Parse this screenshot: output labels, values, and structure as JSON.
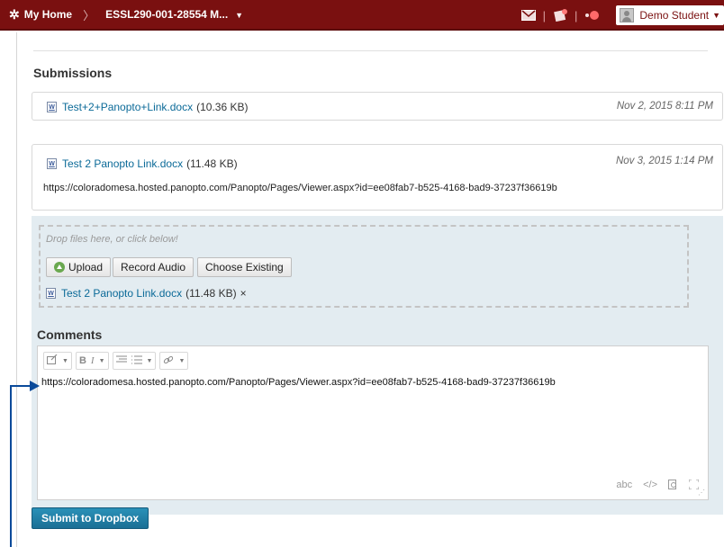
{
  "navbar": {
    "home_label": "My Home",
    "separator": "〉",
    "course_label": "ESSL290-001-28554 M...",
    "user_name": "Demo Student",
    "icons": [
      "home-icon",
      "mail-icon",
      "updates-icon",
      "alerts-icon",
      "avatar"
    ]
  },
  "submissions": {
    "title": "Submissions",
    "items": [
      {
        "file_name": "Test+2+Panopto+Link.docx",
        "file_size": "(10.36 KB)",
        "date": "Nov 2, 2015 8:11 PM",
        "url": ""
      },
      {
        "file_name": "Test 2 Panopto Link.docx",
        "file_size": "(11.48 KB)",
        "date": "Nov 3, 2015 1:14 PM",
        "url": "https://coloradomesa.hosted.panopto.com/Panopto/Pages/Viewer.aspx?id=ee08fab7-b525-4168-bad9-37237f36619b"
      }
    ]
  },
  "upload": {
    "hint": "Drop files here, or click below!",
    "upload_label": "Upload",
    "record_label": "Record Audio",
    "choose_label": "Choose Existing",
    "attached_file": "Test 2 Panopto Link.docx",
    "attached_size": "(11.48 KB)",
    "remove_symbol": "×"
  },
  "comments": {
    "title": "Comments",
    "text": "https://coloradomesa.hosted.panopto.com/Panopto/Pages/Viewer.aspx?id=ee08fab7-b525-4168-bad9-37237f36619b"
  },
  "editor_toolbar": {
    "bold": "B",
    "italic": "I",
    "spellcheck": "abc",
    "source": "</>"
  },
  "submit": {
    "label": "Submit to Dropbox"
  },
  "colors": {
    "navbar": "#7a1010",
    "link": "#0b6a98",
    "shaded_area": "#e3ecf1",
    "submit_button": "#1f7ea6",
    "annotation": "#0a4a9a"
  }
}
